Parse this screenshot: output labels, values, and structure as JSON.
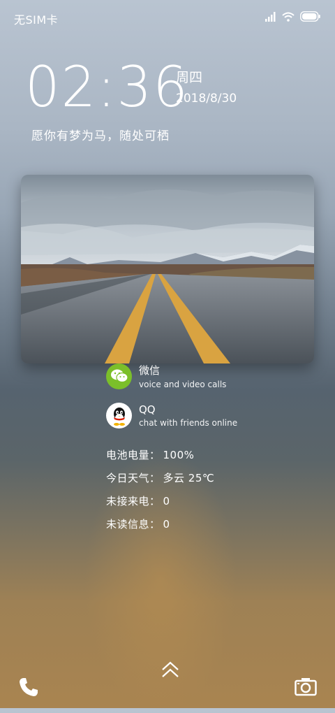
{
  "status_bar": {
    "carrier": "无SIM卡",
    "icons": [
      "signal-icon",
      "wifi-icon",
      "battery-icon"
    ]
  },
  "clock": {
    "time": "02:36",
    "weekday": "周四",
    "date": "2018/8/30"
  },
  "motto": "愿你有梦为马，随处可栖",
  "photo": {
    "subject": "road-landscape"
  },
  "notifications": [
    {
      "app": "微信",
      "text": "voice and video calls",
      "icon": "wechat-icon",
      "color": "#7bbf2a"
    },
    {
      "app": "QQ",
      "text": "chat with friends online",
      "icon": "qq-icon",
      "color": "#ffffff"
    }
  ],
  "info": [
    {
      "label": "电池电量：",
      "value": "100%"
    },
    {
      "label": "今日天气：",
      "value": "多云  25℃"
    },
    {
      "label": "未接来电：",
      "value": "0"
    },
    {
      "label": "未读信息：",
      "value": "0"
    }
  ],
  "bottom": {
    "left_icon": "phone-icon",
    "center_icon": "unlock-chevron-icon",
    "right_icon": "camera-icon"
  }
}
